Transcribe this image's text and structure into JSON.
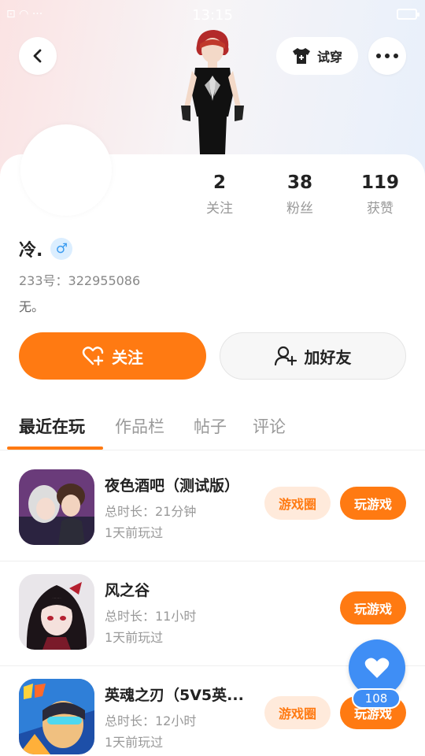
{
  "status_bar": {
    "time": "13:15",
    "left_glyphs": "⊡ ◠ ···"
  },
  "header": {
    "tryon_label": "试穿"
  },
  "stats": [
    {
      "value": "2",
      "label": "关注"
    },
    {
      "value": "38",
      "label": "粉丝"
    },
    {
      "value": "119",
      "label": "获赞"
    }
  ],
  "profile": {
    "nickname": "冷.",
    "gender_symbol": "♂",
    "uid": "233号：322955086",
    "bio": "无。"
  },
  "actions": {
    "follow_label": "关注",
    "add_friend_label": "加好友"
  },
  "tabs": [
    "最近在玩",
    "作品栏",
    "帖子",
    "评论"
  ],
  "games": [
    {
      "title": "夜色酒吧（测试版）",
      "duration": "总时长：21分钟",
      "last_played": "1天前玩过",
      "circle_label": "游戏圈",
      "play_label": "玩游戏"
    },
    {
      "title": "风之谷",
      "duration": "总时长：11小时",
      "last_played": "1天前玩过",
      "play_label": "玩游戏"
    },
    {
      "title": "英魂之刃（5V5英...",
      "duration": "总时长：12小时",
      "last_played": "1天前玩过",
      "circle_label": "游戏圈",
      "play_label": "玩游戏"
    }
  ],
  "like_fab": {
    "count": "108"
  },
  "colors": {
    "accent": "#ff7a12",
    "like_blue": "#3f8ef5",
    "muted_text": "#999999"
  },
  "icons": [
    "back-arrow-icon",
    "tshirt-icon",
    "more-icon",
    "heart-plus-icon",
    "add-user-icon",
    "heart-icon",
    "male-icon"
  ]
}
